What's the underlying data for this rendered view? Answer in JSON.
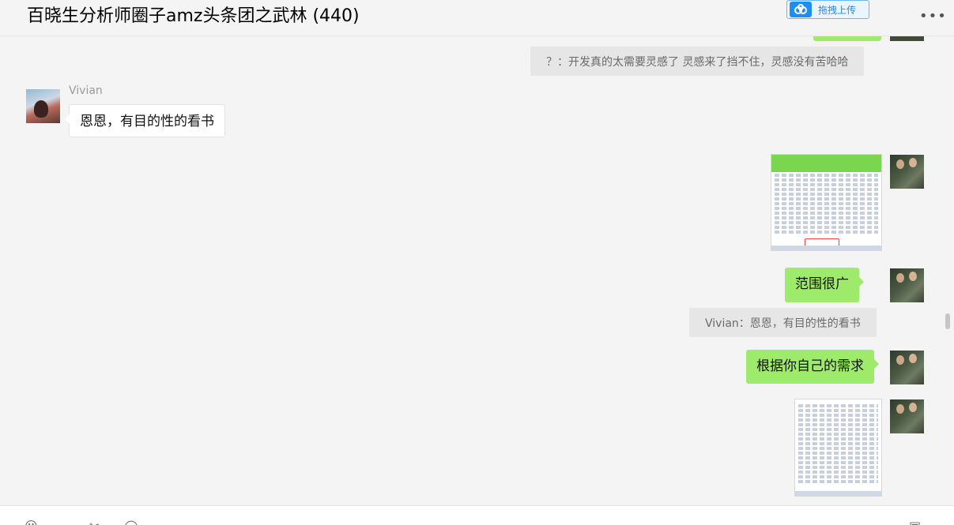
{
  "header": {
    "title": "百晓生分析师圈子amz头条团之武林 (440)",
    "upload_label": "拖拽上传",
    "upload_icon": "cloud-upload-icon",
    "more_icon": "more-dots-icon"
  },
  "messages": {
    "quote_top": "？：开发真的太需要灵感了 灵感来了挡不住，灵感没有苦哈哈",
    "vivian_name": "Vivian",
    "vivian_text": "恩恩，有目的性的看书",
    "my_text_1": "范围很广",
    "quote_mid": "Vivian：恩恩，有目的性的看书",
    "my_text_2": "根据你自己的需求"
  },
  "toolbar": {
    "icons": [
      "emoji-icon",
      "folder-icon",
      "scissors-icon",
      "chat-history-icon",
      "video-call-icon"
    ]
  },
  "colors": {
    "bubble_mine": "#9eea6a",
    "bubble_other": "#ffffff",
    "background": "#f4f4f4",
    "accent": "#1e8ff0"
  }
}
